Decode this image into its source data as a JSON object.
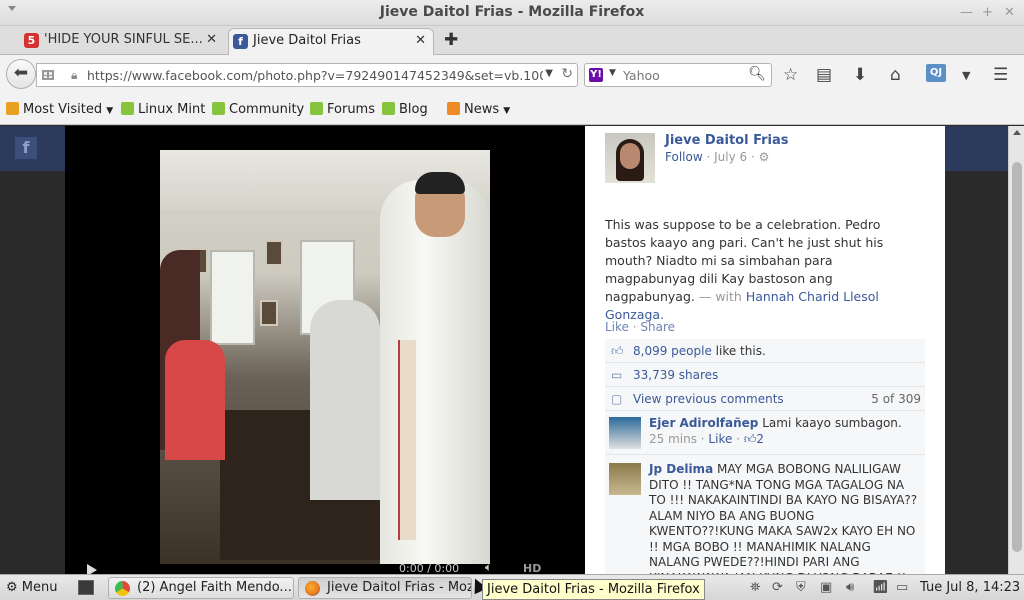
{
  "window": {
    "title": "Jieve Daitol Frias - Mozilla Firefox"
  },
  "tabs": [
    {
      "label": "'HIDE YOUR SINFUL SE...",
      "favicon": "5",
      "favicon_color": "#d63030"
    },
    {
      "label": "Jieve Daitol Frias",
      "favicon": "f",
      "favicon_color": "#3b5998"
    }
  ],
  "navbar": {
    "url": "https://www.facebook.com/photo.php?v=792490147452349&set=vb.100(",
    "search_placeholder": "Yahoo",
    "search_engine_icon": "Y!"
  },
  "bookmarks": [
    {
      "label": "Most Visited",
      "has_dropdown": true,
      "icon_color": "#e8a020"
    },
    {
      "label": "Linux Mint",
      "icon_color": "#86c440"
    },
    {
      "label": "Community",
      "icon_color": "#86c440"
    },
    {
      "label": "Forums",
      "icon_color": "#86c440"
    },
    {
      "label": "Blog",
      "icon_color": "#86c440"
    },
    {
      "label": "News",
      "has_dropdown": true,
      "icon_color": "#f08a24"
    }
  ],
  "video": {
    "time": "0:00 / 0:00",
    "hd": "HD"
  },
  "post": {
    "author": "Jieve Daitol Frias",
    "follow": "Follow",
    "date": "· July 6 ·",
    "caption": "This was suppose to be a celebration. Pedro bastos kaayo ang pari. Can't he just shut his mouth? Niadto mi sa simbahan para magpabunyag dili Kay bastoson ang nagpabunyag.",
    "with_text": "— with",
    "tagged": "Hannah Charid Llesol Gonzaga.",
    "like": "Like",
    "share": "Share"
  },
  "ufi": {
    "likes_count": "8,099 people",
    "likes_suffix": "like this.",
    "shares": "33,739 shares",
    "view_previous": "View previous comments",
    "comment_count": "5 of 309"
  },
  "comments": [
    {
      "name": "Ejer Adirolfañep",
      "text": "Lami kaayo sumbagon.",
      "time": "25 mins",
      "like": "Like",
      "likes": "2"
    },
    {
      "name": "Jp Delima",
      "text": "MAY MGA BOBONG NALILIGAW DITO !! TANG*NA TONG MGA TAGALOG NA TO !!! NAKAKAINTINDI BA KAYO NG BISAYA??ALAM NIYO BA ANG BUONG KWENTO??!KUNG MAKA SAW2x KAYO EH NO !! MGA BOBO !! MANAHIMIK NALANG NALANG PWEDE??!HINDI PARI ANG KINAKAWAWA JAN KUNG DI YONG BABAE !!"
    }
  ],
  "taskbar": {
    "menu": "Menu",
    "tasks": [
      {
        "label": "(2) Angel Faith Mendo...",
        "icon_color": "#e04a3a"
      },
      {
        "label": "Jieve Daitol Frias - Mozil...",
        "icon_color": "#e8781e"
      }
    ],
    "clock": "Tue Jul  8, 14:23",
    "tooltip": "Jieve Daitol Frias - Mozilla Firefox"
  }
}
